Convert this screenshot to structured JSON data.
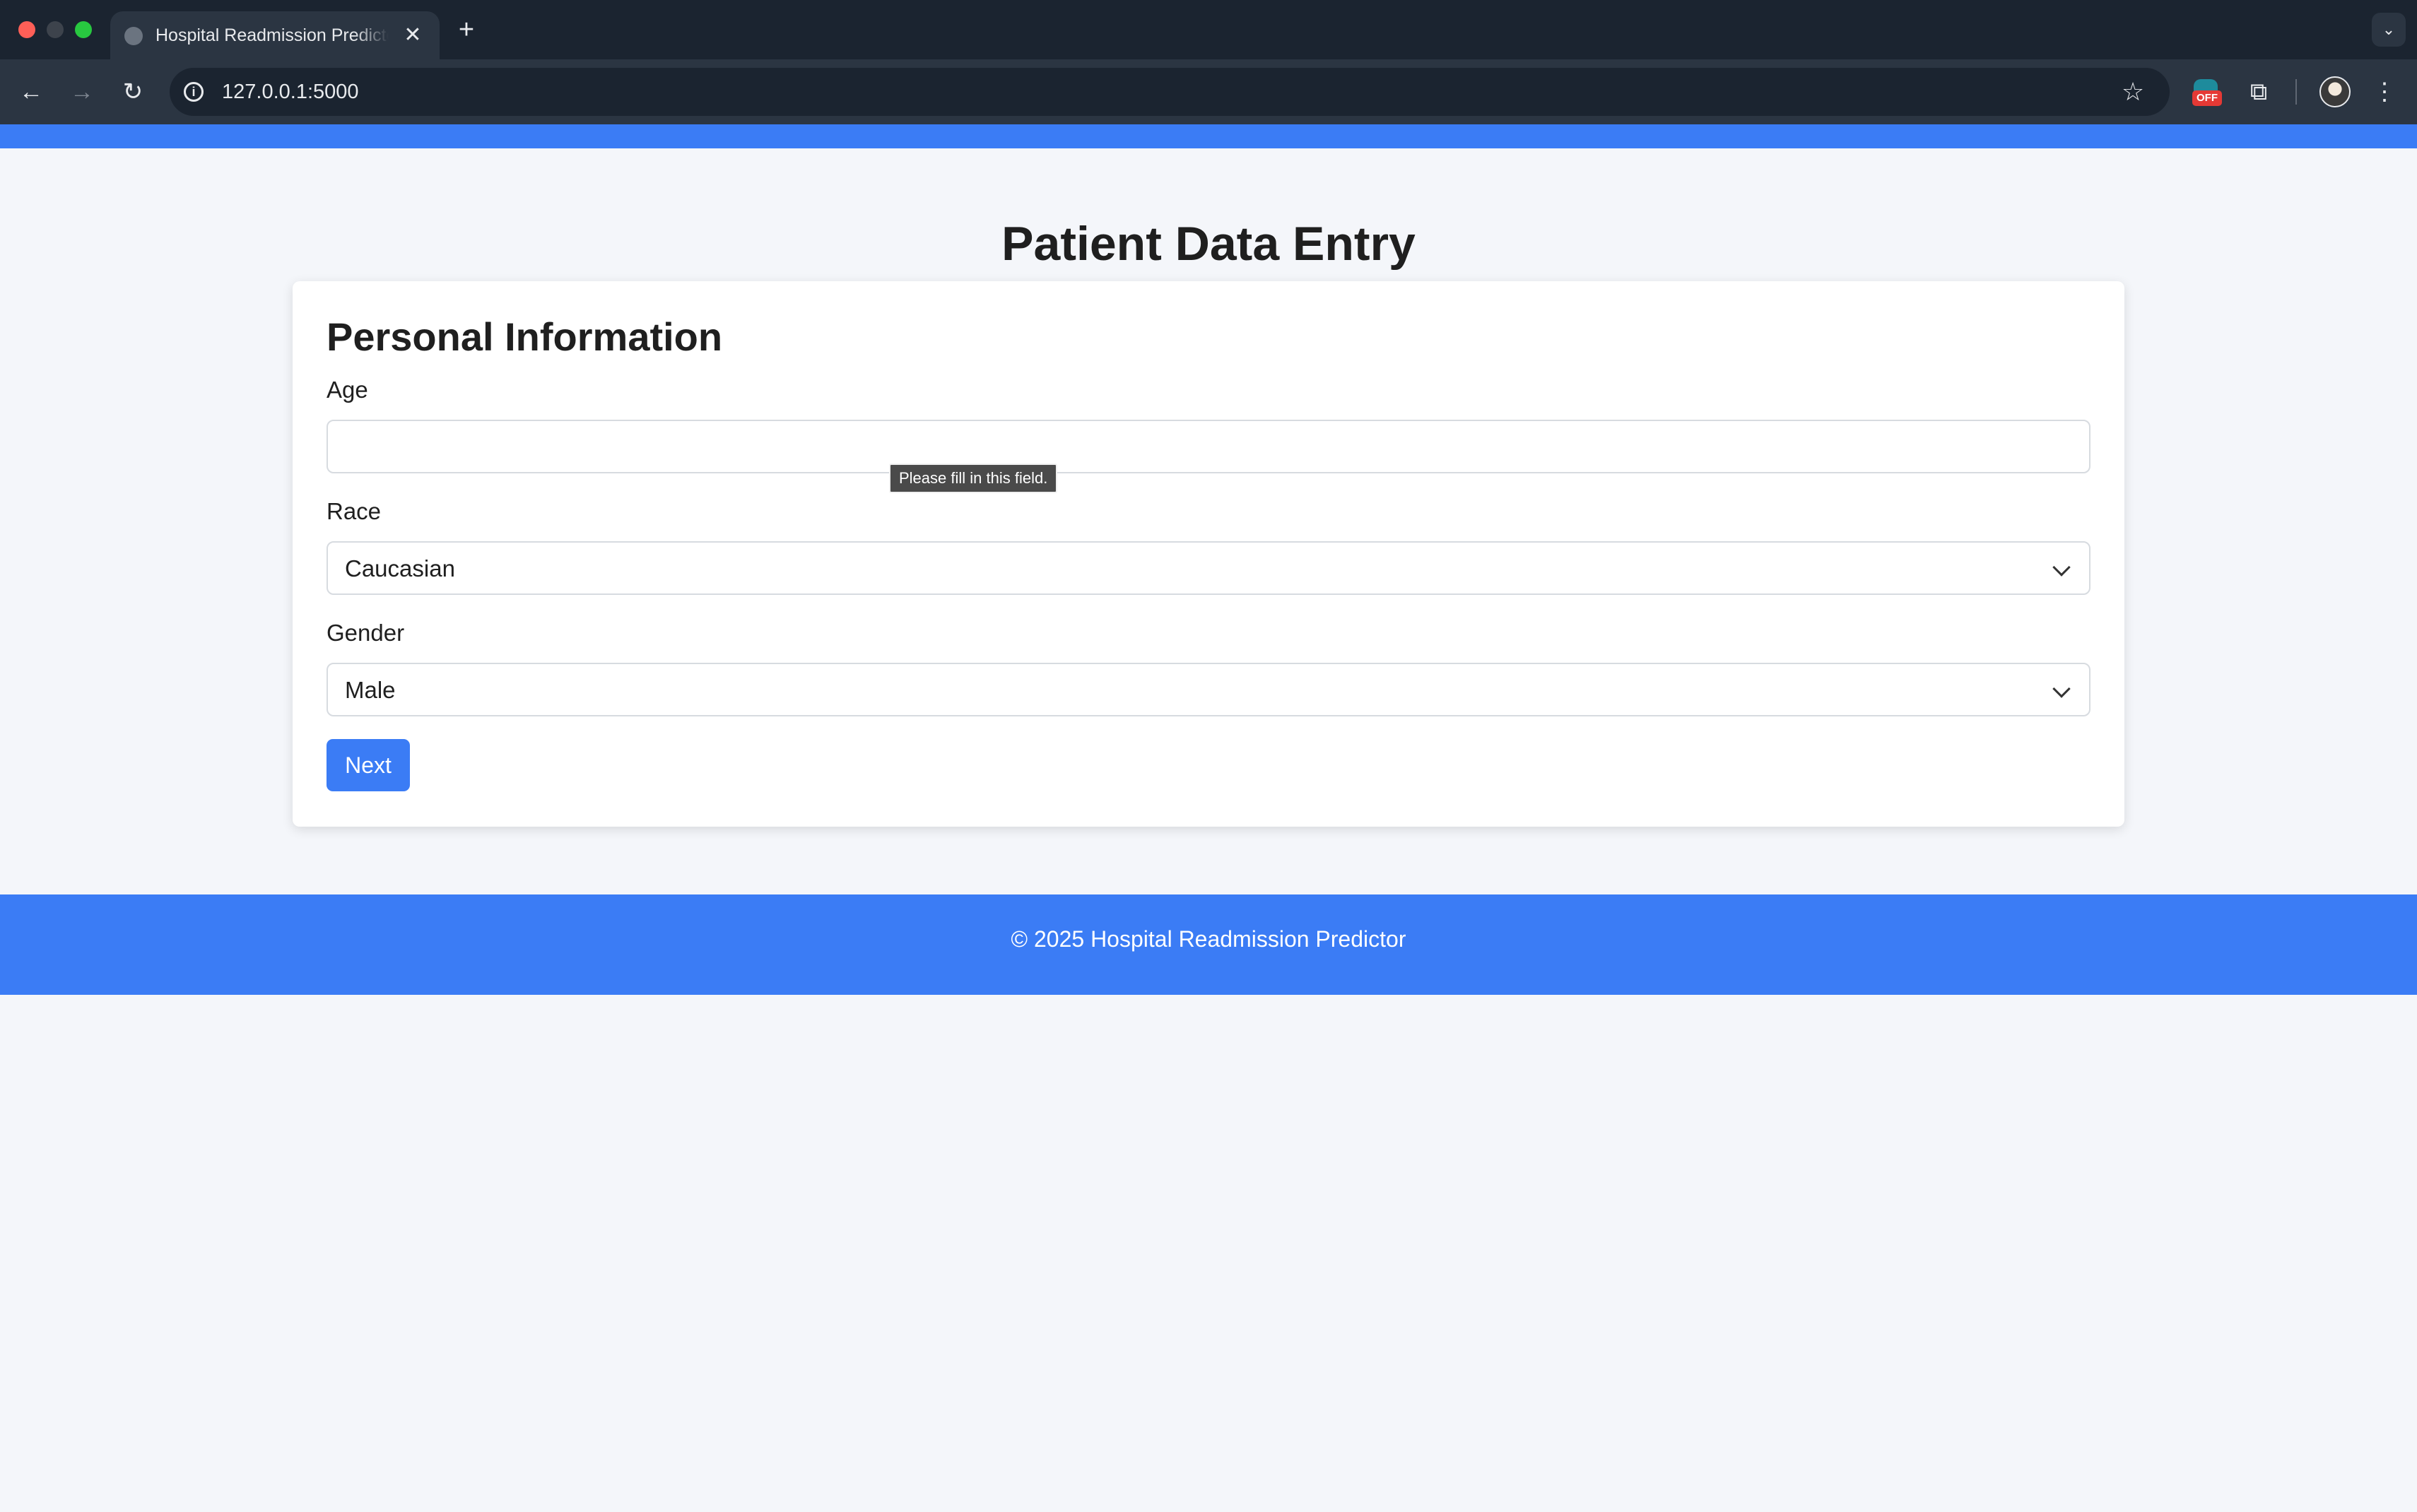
{
  "browser": {
    "tab_title": "Hospital Readmission Predictor",
    "url": "127.0.0.1:5000",
    "extension_badge": "OFF",
    "icons": {
      "close": "✕",
      "new_tab": "+",
      "tab_search": "⌄",
      "back": "←",
      "forward": "→",
      "reload": "↻",
      "info": "i",
      "star": "☆",
      "puzzle": "⧉",
      "menu": "⋮"
    }
  },
  "page": {
    "title": "Patient Data Entry",
    "section_title": "Personal Information",
    "fields": {
      "age": {
        "label": "Age",
        "value": ""
      },
      "race": {
        "label": "Race",
        "value": "Caucasian"
      },
      "gender": {
        "label": "Gender",
        "value": "Male"
      }
    },
    "validation_tooltip": "Please fill in this field.",
    "next_label": "Next",
    "footer_text": "© 2025 Hospital Readmission Predictor"
  },
  "colors": {
    "accent": "#3b7cf5",
    "page_bg": "#f4f6fa",
    "chrome_dark": "#1b2430",
    "chrome_toolbar": "#2b3542"
  }
}
